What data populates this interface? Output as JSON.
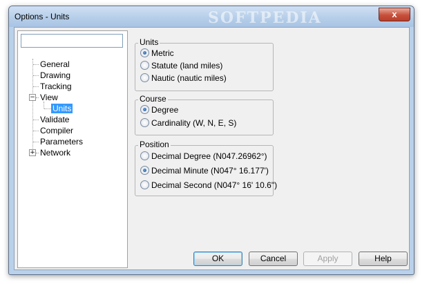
{
  "window": {
    "title": "Options - Units",
    "watermark": "SOFTPEDIA",
    "close_glyph": "x"
  },
  "tree": {
    "search_value": "",
    "items": [
      {
        "label": "General"
      },
      {
        "label": "Drawing"
      },
      {
        "label": "Tracking"
      },
      {
        "label": "View",
        "expander": "−"
      },
      {
        "label": "Units",
        "selected": true
      },
      {
        "label": "Validate"
      },
      {
        "label": "Compiler"
      },
      {
        "label": "Parameters"
      },
      {
        "label": "Network",
        "expander": "+"
      }
    ]
  },
  "units": {
    "title": "Units",
    "options": [
      {
        "label": "Metric",
        "checked": true
      },
      {
        "label": "Statute (land miles)",
        "checked": false
      },
      {
        "label": "Nautic (nautic miles)",
        "checked": false
      }
    ]
  },
  "course": {
    "title": "Course",
    "options": [
      {
        "label": "Degree",
        "checked": true
      },
      {
        "label": "Cardinality (W, N, E, S)",
        "checked": false
      }
    ]
  },
  "position": {
    "title": "Position",
    "options": [
      {
        "label": "Decimal Degree (N047.26962°)",
        "checked": false
      },
      {
        "label": "Decimal Minute (N047° 16.177')",
        "checked": true
      },
      {
        "label": "Decimal Second (N047° 16' 10.6\")",
        "checked": false
      }
    ]
  },
  "buttons": {
    "ok": "OK",
    "cancel": "Cancel",
    "apply": "Apply",
    "help": "Help"
  }
}
